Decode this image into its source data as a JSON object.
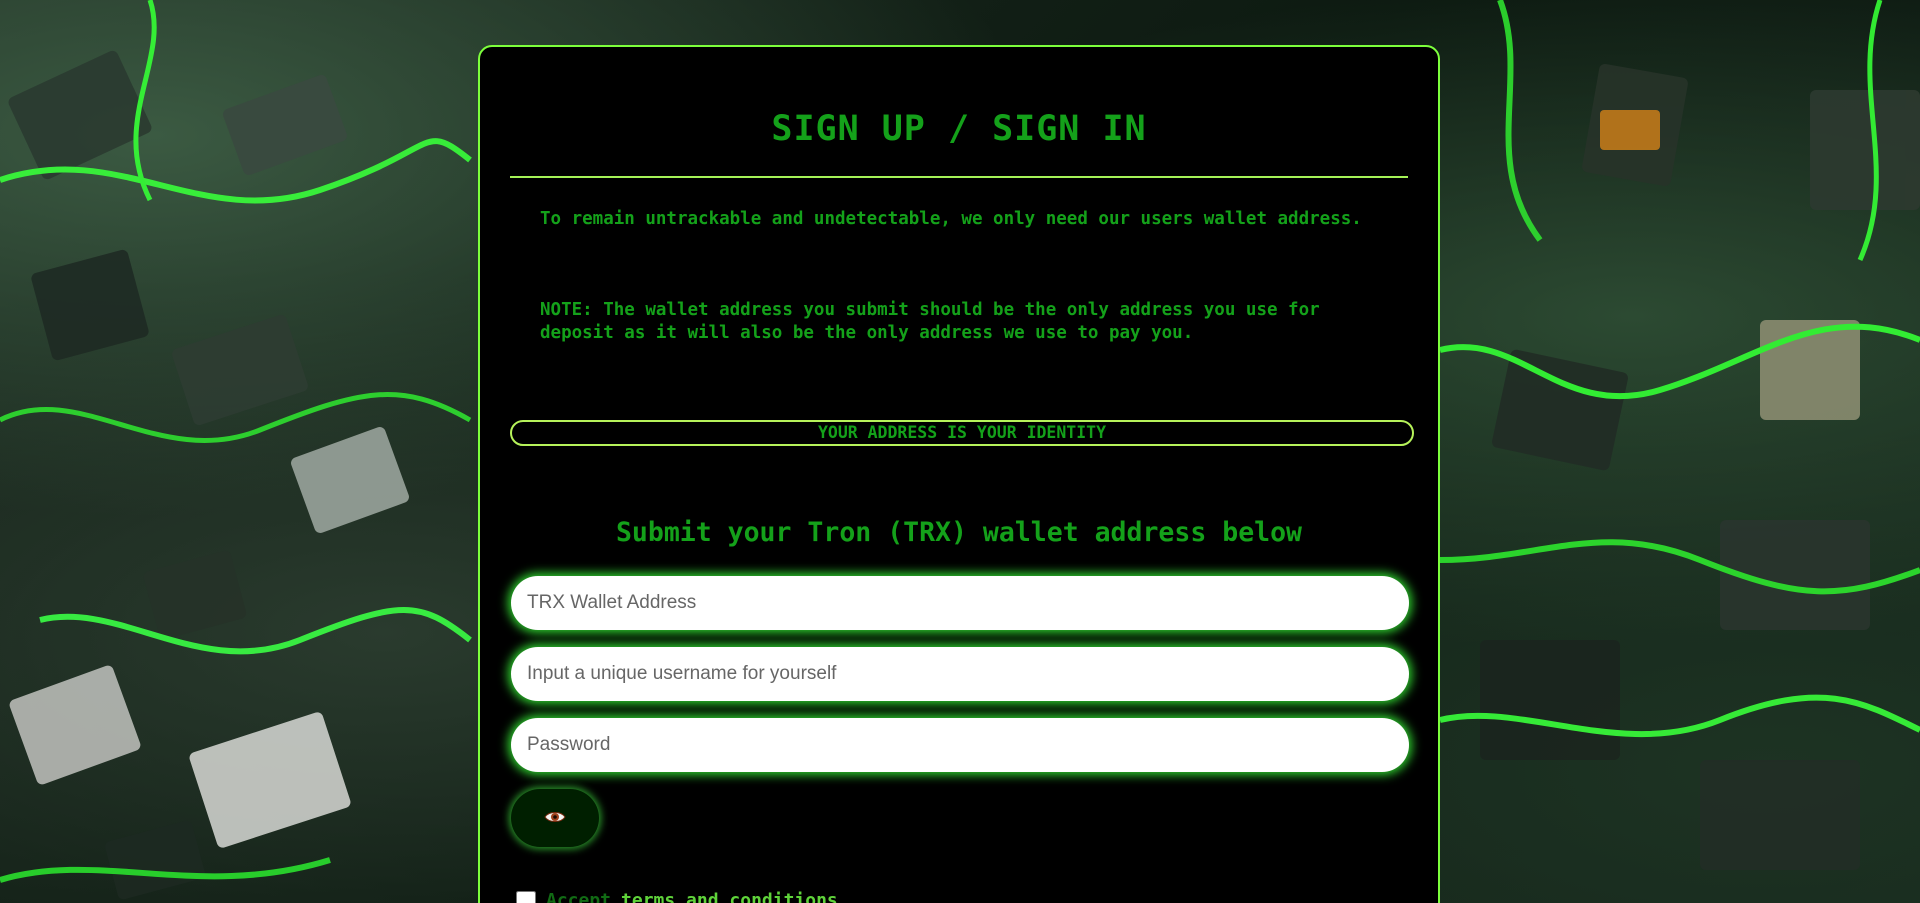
{
  "page": {
    "title": "SIGN UP / SIGN IN",
    "intro": "To remain untrackable and undetectable, we only need our users wallet address.",
    "note": "NOTE: The wallet address you submit should be the only address you use for deposit as it will also be the only address we use to pay you.",
    "identity_banner": "YOUR ADDRESS IS YOUR IDENTITY",
    "subheading": "Submit your Tron (TRX) wallet address below"
  },
  "form": {
    "wallet": {
      "value": "",
      "placeholder": "TRX Wallet Address"
    },
    "username": {
      "value": "",
      "placeholder": "Input a unique username for yourself"
    },
    "password": {
      "value": "",
      "placeholder": "Password"
    },
    "toggle_password_icon": "eye-icon",
    "terms": {
      "checked": false,
      "accept_label": "Accept",
      "link_label": "terms and conditions"
    }
  },
  "colors": {
    "accent_green": "#14a11a",
    "border_green": "#7dff3c",
    "card_background": "#000000"
  }
}
